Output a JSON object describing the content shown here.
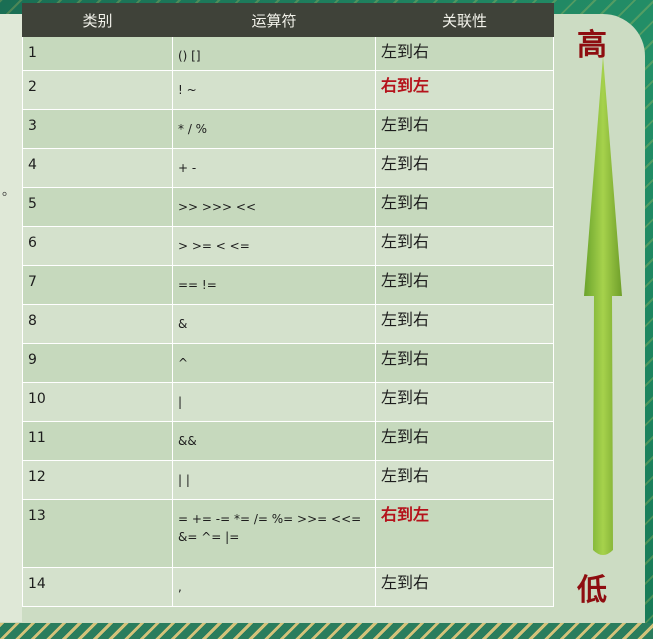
{
  "table": {
    "headers": [
      "类别",
      "运算符",
      "关联性"
    ],
    "rows": [
      {
        "category": "1",
        "operator": "() []",
        "assoc": "左到右",
        "rtl": false
      },
      {
        "category": "2",
        "operator": "! ~",
        "assoc": "右到左",
        "rtl": true
      },
      {
        "category": "3",
        "operator": "* / %",
        "assoc": "左到右",
        "rtl": false
      },
      {
        "category": "4",
        "operator": "+ -",
        "assoc": "左到右",
        "rtl": false
      },
      {
        "category": "5",
        "operator": ">> >>> <<",
        "assoc": "左到右",
        "rtl": false
      },
      {
        "category": "6",
        "operator": "> >= < <=",
        "assoc": "左到右",
        "rtl": false
      },
      {
        "category": "7",
        "operator": "== !=",
        "assoc": "左到右",
        "rtl": false
      },
      {
        "category": "8",
        "operator": "&",
        "assoc": "左到右",
        "rtl": false
      },
      {
        "category": "9",
        "operator": "^",
        "assoc": "左到右",
        "rtl": false
      },
      {
        "category": "10",
        "operator": "|",
        "assoc": "左到右",
        "rtl": false
      },
      {
        "category": "11",
        "operator": "&&",
        "assoc": "左到右",
        "rtl": false
      },
      {
        "category": "12",
        "operator": "| |",
        "assoc": "左到右",
        "rtl": false
      },
      {
        "category": "13",
        "operator": "= += -= *= /= %= >>= <<= &= ^= |=",
        "assoc": "右到左",
        "rtl": true
      },
      {
        "category": "14",
        "operator": ",",
        "assoc": "左到右",
        "rtl": false
      }
    ]
  },
  "priority": {
    "high": "高",
    "low": "低"
  },
  "left_margin_text": [
    "。"
  ],
  "colors": {
    "rtl": "#b5121b",
    "arrow": "#8fc23c",
    "header": "#3f4239"
  }
}
